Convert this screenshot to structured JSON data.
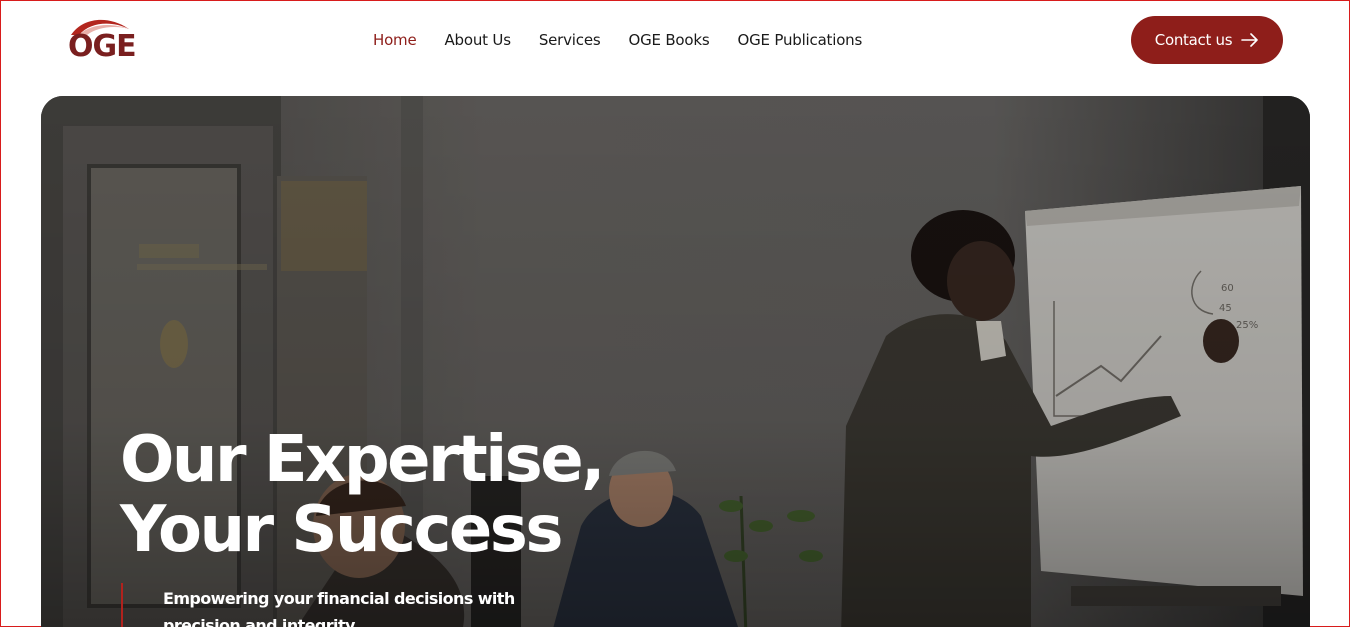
{
  "brand": {
    "logo_text": "OGE",
    "accent_color": "#8e1e1a"
  },
  "nav": {
    "items": [
      {
        "label": "Home",
        "active": true
      },
      {
        "label": "About Us",
        "active": false
      },
      {
        "label": "Services",
        "active": false
      },
      {
        "label": "OGE Books",
        "active": false
      },
      {
        "label": "OGE Publications",
        "active": false
      }
    ]
  },
  "cta": {
    "label": "Contact us",
    "icon": "arrow-right-icon"
  },
  "hero": {
    "title_line1": "Our Expertise,",
    "title_line2": "Your Success",
    "subtitle": "Empowering your financial decisions with precision and integrity",
    "background_image": "team-meeting-whiteboard-photo"
  }
}
